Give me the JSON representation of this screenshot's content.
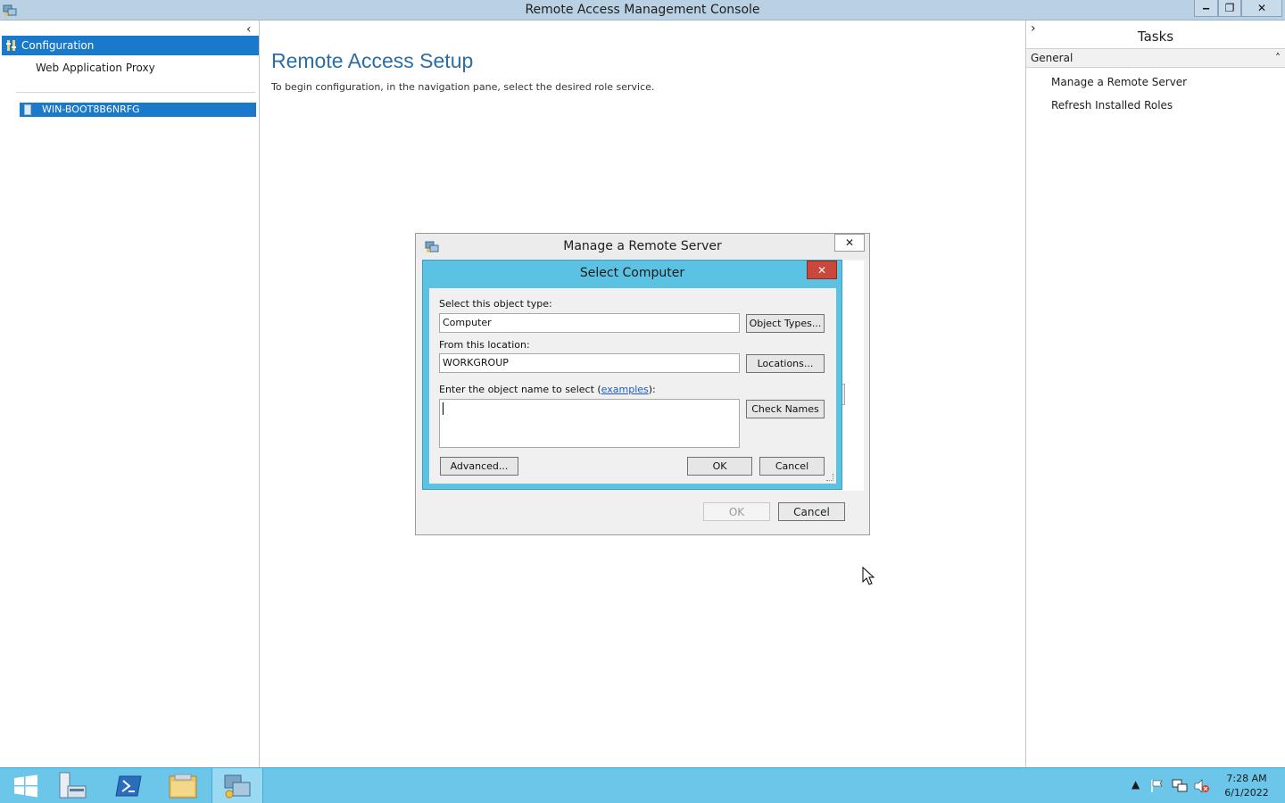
{
  "window": {
    "title": "Remote Access Management Console",
    "controls": {
      "minimize": "‒",
      "maximize": "❐",
      "close": "✕"
    }
  },
  "nav": {
    "collapse_glyph": "‹",
    "config_label": "Configuration",
    "wap_label": "Web Application Proxy",
    "server_label": "WIN-BOOT8B6NRFG"
  },
  "main": {
    "title": "Remote Access Setup",
    "description": "To begin configuration, in the navigation pane, select the desired role service."
  },
  "tasks": {
    "expand_glyph": "›",
    "title": "Tasks",
    "section": "General",
    "section_glyph": "˄",
    "items": [
      "Manage a Remote Server",
      "Refresh Installed Roles"
    ]
  },
  "outer_dialog": {
    "title": "Manage a Remote Server",
    "close_glyph": "✕",
    "ok_label": "OK",
    "cancel_label": "Cancel"
  },
  "select_dialog": {
    "title": "Select Computer",
    "close_glyph": "✕",
    "object_type_label": "Select this object type:",
    "object_type_value": "Computer",
    "object_types_button": "Object Types...",
    "location_label": "From this location:",
    "location_value": "WORKGROUP",
    "locations_button": "Locations...",
    "object_name_label_prefix": "Enter the object name to select (",
    "object_name_link": "examples",
    "object_name_label_suffix": "):",
    "object_name_value": "",
    "check_names_button": "Check Names",
    "advanced_button": "Advanced...",
    "ok_label": "OK",
    "cancel_label": "Cancel"
  },
  "taskbar": {
    "clock_time": "7:28 AM",
    "clock_date": "6/1/2022",
    "tray_arrow": "▲"
  },
  "colors": {
    "accent_blue": "#1979ca",
    "title_teal": "#2c6ea3",
    "taskbar": "#6bc6ea",
    "select_dialog_frame": "#5bc2e4",
    "close_red": "#c9473b"
  }
}
